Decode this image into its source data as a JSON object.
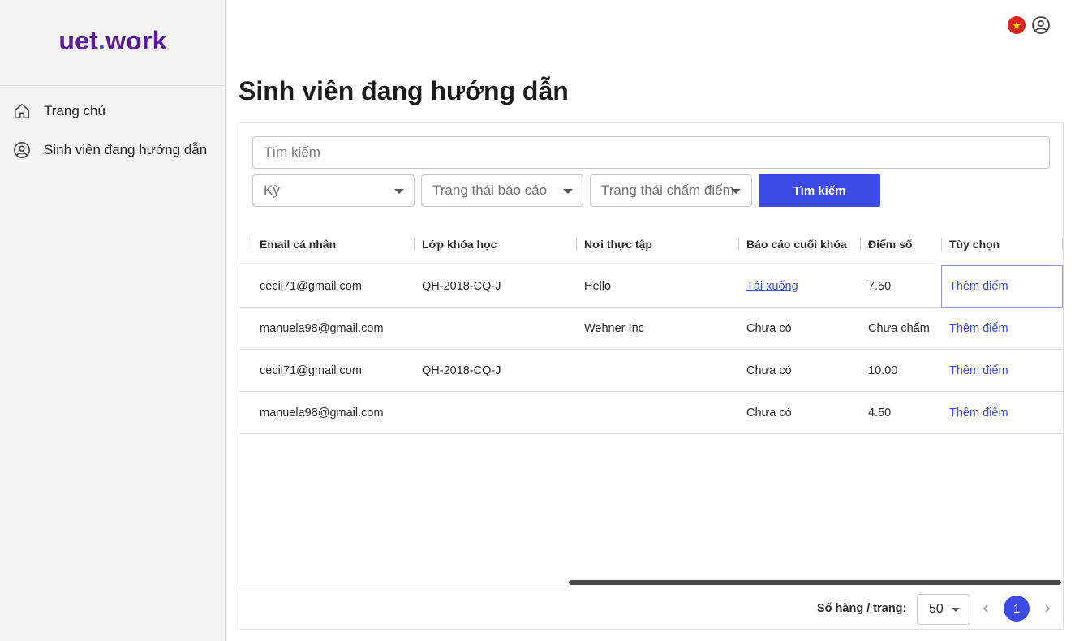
{
  "app": {
    "logo_main": "uet",
    "logo_dot": ".",
    "logo_suffix": "work"
  },
  "sidebar": {
    "items": [
      {
        "label": "Trang chủ",
        "icon": "home-icon"
      },
      {
        "label": "Sinh viên đang hướng dẫn",
        "icon": "user-circle-icon"
      }
    ]
  },
  "topbar": {
    "language_flag": "vietnam-flag-icon",
    "flag_star": "★",
    "user_icon": "user-circle-icon",
    "colors": {
      "flag_red": "#da251d",
      "flag_star": "#ffde00"
    }
  },
  "page": {
    "title": "Sinh viên đang hướng dẫn"
  },
  "filters": {
    "search_placeholder": "Tìm kiếm",
    "term_placeholder": "Kỳ",
    "report_status_placeholder": "Trạng thái báo cáo",
    "grading_status_placeholder": "Trạng thái chấm điểm",
    "search_button": "Tìm kiếm"
  },
  "table": {
    "columns": [
      "Email cá nhân",
      "Lớp khóa học",
      "Nơi thực tập",
      "Báo cáo cuối khóa",
      "Điểm số",
      "Tùy chọn"
    ],
    "rows": [
      {
        "email": "cecil71@gmail.com",
        "class": "QH-2018-CQ-J",
        "company": "Hello",
        "report": "Tải xuống",
        "report_is_link": true,
        "score": "7.50",
        "action": "Thêm điểm"
      },
      {
        "email": "manuela98@gmail.com",
        "class": "",
        "company": "Wehner Inc",
        "report": "Chưa có",
        "report_is_link": false,
        "score": "Chưa chấm",
        "action": "Thêm điểm"
      },
      {
        "email": "cecil71@gmail.com",
        "class": "QH-2018-CQ-J",
        "company": "",
        "report": "Chưa có",
        "report_is_link": false,
        "score": "10.00",
        "action": "Thêm điểm"
      },
      {
        "email": "manuela98@gmail.com",
        "class": "",
        "company": "",
        "report": "Chưa có",
        "report_is_link": false,
        "score": "4.50",
        "action": "Thêm điểm"
      }
    ]
  },
  "pagination": {
    "rows_per_page_label": "Số hàng / trang:",
    "rows_per_page_value": "50",
    "current_page": "1"
  },
  "colors": {
    "accent": "#3d4ae6",
    "logo": "#5b1a9a",
    "sidebar_bg": "#f4f4f4"
  }
}
